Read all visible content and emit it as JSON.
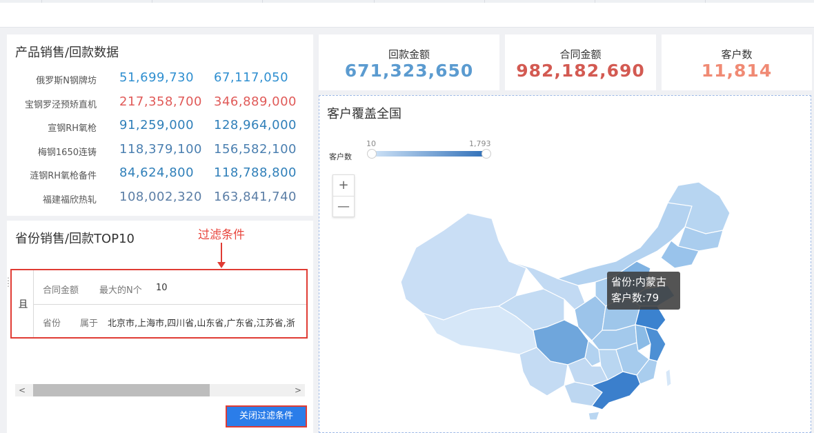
{
  "product_panel": {
    "title": "产品销售/回款数据",
    "rows": [
      {
        "name": "俄罗斯N钢牌坊",
        "v1": "51,699,730",
        "v2": "67,117,050",
        "color": "#2f8fd0"
      },
      {
        "name": "宝钢罗泾预矫直机",
        "v1": "217,358,700",
        "v2": "346,889,000",
        "color": "#e05a58"
      },
      {
        "name": "宣钢RH氧枪",
        "v1": "91,259,000",
        "v2": "128,964,000",
        "color": "#2f7fb9"
      },
      {
        "name": "梅钢1650连铸",
        "v1": "118,379,100",
        "v2": "156,582,100",
        "color": "#4a7fb0"
      },
      {
        "name": "涟钢RH氧枪备件",
        "v1": "84,624,800",
        "v2": "118,788,800",
        "color": "#2f7fb9"
      },
      {
        "name": "福建福欣热轧",
        "v1": "108,002,320",
        "v2": "163,841,740",
        "color": "#5b7ea6"
      }
    ]
  },
  "kpis": [
    {
      "label": "回款金额",
      "value": "671,323,650",
      "color": "#5b9bd0"
    },
    {
      "label": "合同金额",
      "value": "982,182,690",
      "color": "#d35a52"
    },
    {
      "label": "客户数",
      "value": "11,814",
      "color": "#f08a74"
    }
  ],
  "province_panel": {
    "title": "省份销售/回款TOP10",
    "annotation": "过滤条件",
    "filter": {
      "logic": "且",
      "rules": [
        {
          "field": "合同金额",
          "op": "最大的N个",
          "value": "10"
        },
        {
          "field": "省份",
          "op": "属于",
          "value": "北京市,上海市,四川省,山东省,广东省,江苏省,浙"
        }
      ]
    },
    "scroll_left": "<",
    "scroll_right": ">",
    "close_button": "关闭过滤条件"
  },
  "map_panel": {
    "title": "客户覆盖全国",
    "legend": {
      "label": "客户数",
      "min": "10",
      "max": "1,793"
    },
    "zoom_in": "+",
    "zoom_out": "—",
    "tooltip": {
      "line1": "省份:内蒙古",
      "line2": "客户数:79"
    }
  }
}
